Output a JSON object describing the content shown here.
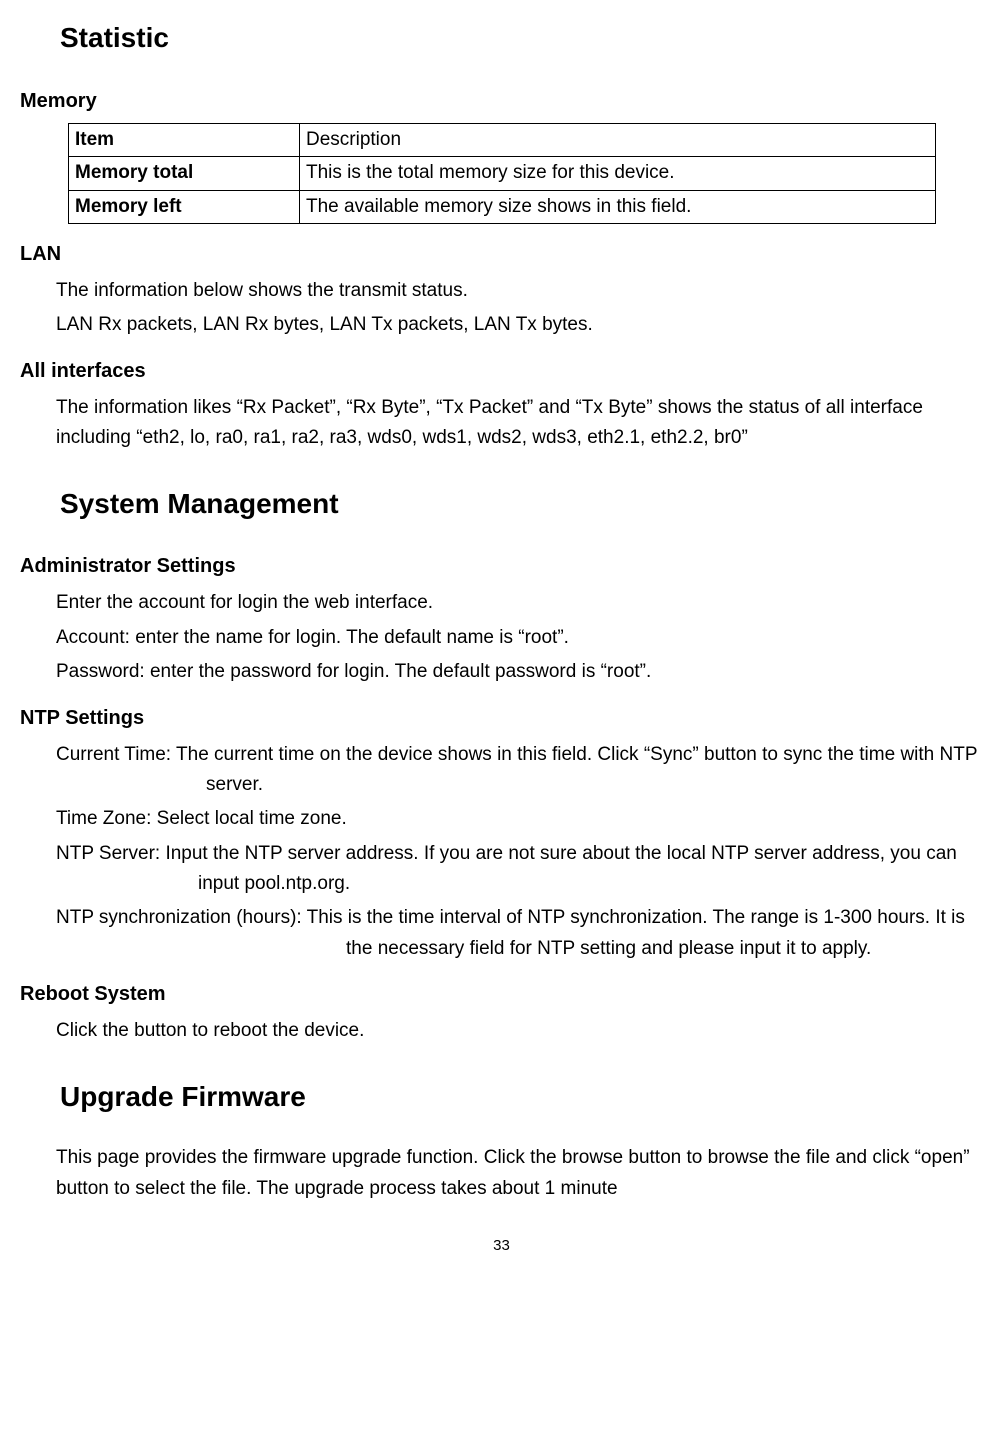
{
  "statistic": {
    "heading": "Statistic",
    "memory": {
      "title": "Memory",
      "table": {
        "header_item": "Item",
        "header_desc": "Description",
        "rows": [
          {
            "item": "Memory total",
            "desc": "This is the total memory size for this device."
          },
          {
            "item": "Memory left",
            "desc": "The available memory size shows in this field."
          }
        ]
      }
    },
    "lan": {
      "title": "LAN",
      "line1": "The information below shows the transmit status.",
      "line2": "LAN Rx packets, LAN Rx bytes, LAN Tx packets, LAN Tx bytes."
    },
    "all_interfaces": {
      "title": "All interfaces",
      "body": "The information likes “Rx Packet”, “Rx Byte”, “Tx Packet” and “Tx Byte” shows the status of all interface including “eth2, lo, ra0, ra1, ra2, ra3, wds0, wds1, wds2, wds3, eth2.1, eth2.2, br0”"
    }
  },
  "system_management": {
    "heading": "System Management",
    "admin": {
      "title": "Administrator Settings",
      "line1": "Enter the account for login the web interface.",
      "line2": "Account: enter the name for login. The default name is “root”.",
      "line3": "Password: enter the password for login. The default password is “root”."
    },
    "ntp": {
      "title": "NTP Settings",
      "current_time": "Current Time: The current time on the device shows in this field. Click “Sync” button to sync the time with NTP server.",
      "time_zone": "Time Zone: Select local time zone.",
      "ntp_server": "NTP Server: Input the NTP server address. If you are not sure about the local NTP server address, you can input pool.ntp.org.",
      "ntp_sync": "NTP synchronization (hours): This is the time interval of NTP synchronization. The range is 1-300 hours. It is the necessary field for NTP setting and please input it to apply."
    },
    "reboot": {
      "title": "Reboot System",
      "body": "Click the button to reboot the device."
    }
  },
  "upgrade_firmware": {
    "heading": "Upgrade Firmware",
    "body": "This page provides the firmware upgrade function. Click the browse button to browse the file and click “open” button to select the file. The upgrade process takes about 1 minute"
  },
  "page_number": "33"
}
